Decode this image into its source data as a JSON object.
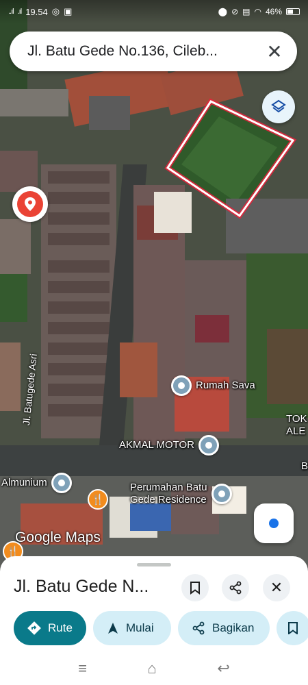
{
  "status_bar": {
    "time": "19.54",
    "signal_left": "..ıl",
    "signal_right": ".ıl",
    "battery": "46%"
  },
  "search": {
    "query": "Jl. Batu Gede No.136, Cileb..."
  },
  "map": {
    "street_label": "Jl. Batugede Asri",
    "places": [
      {
        "name": "Rumah Sava"
      },
      {
        "name": "AKMAL MOTOR"
      },
      {
        "name": "Almunium"
      },
      {
        "name_line1": "Perumahan Batu",
        "name_line2": "Gede Residence"
      },
      {
        "name_line1": "TOK",
        "name_line2": "ALE"
      },
      {
        "name": "B"
      }
    ],
    "logo": "Google Maps"
  },
  "sheet": {
    "title": "Jl. Batu Gede N...",
    "actions": {
      "route": "Rute",
      "start": "Mulai",
      "share": "Bagikan"
    }
  },
  "colors": {
    "primary_chip": "#0a7a8a",
    "chip": "#d4eef7",
    "highlight": "#e8223a",
    "pin": "#ea4335"
  }
}
